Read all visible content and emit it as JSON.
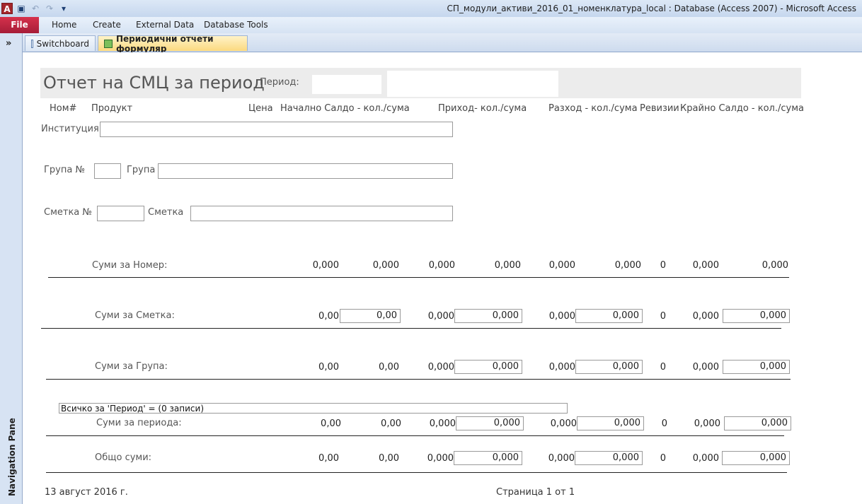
{
  "window": {
    "title": "СП_модули_активи_2016_01_номенклатура_local : Database (Access 2007)  -  Microsoft Access",
    "app_logo": "A"
  },
  "quick_access": {
    "save_icon": "save-icon",
    "undo_icon": "undo-icon",
    "redo_icon": "redo-icon"
  },
  "ribbon": {
    "file": "File",
    "tabs": [
      "Home",
      "Create",
      "External Data",
      "Database Tools"
    ]
  },
  "nav_pane": {
    "toggle": "»",
    "label": "Navigation Pane"
  },
  "doc_tabs": [
    {
      "label": "Switchboard",
      "active": false
    },
    {
      "label": "Периодични отчети формуляр",
      "active": true
    }
  ],
  "report": {
    "title": "Отчет на СМЦ за период",
    "period_label": "Период:",
    "columns": [
      "Ном#",
      "Продукт",
      "Цена",
      "Начално Салдо - кол./сума",
      "Приход- кол./сума",
      "Разход - кол./сума",
      "Ревизии",
      "Крайно Салдо - кол./сума"
    ],
    "fields": {
      "institution": "Институция",
      "group_no": "Група №",
      "group": "Група",
      "account_no": "Сметка №",
      "account": "Сметка"
    },
    "rows": [
      {
        "label": "Суми за Номер:",
        "values": [
          "0,000",
          "0,000",
          "0,000",
          "0,000",
          "0,000",
          "0,000",
          "0",
          "0,000",
          "0,000"
        ]
      },
      {
        "label": "Суми за Сметка:",
        "values": [
          "0,00",
          "0,00",
          "0,000",
          "0,000",
          "0,000",
          "0,000",
          "0",
          "0,000",
          "0,000"
        ]
      },
      {
        "label": "Суми за Група:",
        "values": [
          "0,00",
          "0,00",
          "0,000",
          "0,000",
          "0,000",
          "0,000",
          "0",
          "0,000",
          "0,000"
        ]
      },
      {
        "label": "Суми за периода:",
        "values": [
          "0,00",
          "0,00",
          "0,000",
          "0,000",
          "0,000",
          "0,000",
          "0",
          "0,000",
          "0,000"
        ]
      },
      {
        "label": "Общо суми:",
        "values": [
          "0,00",
          "0,00",
          "0,000",
          "0,000",
          "0,000",
          "0,000",
          "0",
          "0,000",
          "0,000"
        ]
      }
    ],
    "summary": "Всичко за 'Период' =   (0 записи)",
    "footer_date": "13 август 2016 г.",
    "footer_page": "Страница 1 от 1"
  },
  "colors": {
    "file_tab": "#b8213f",
    "active_tab": "#fbd97f",
    "header_band": "#ececec"
  }
}
